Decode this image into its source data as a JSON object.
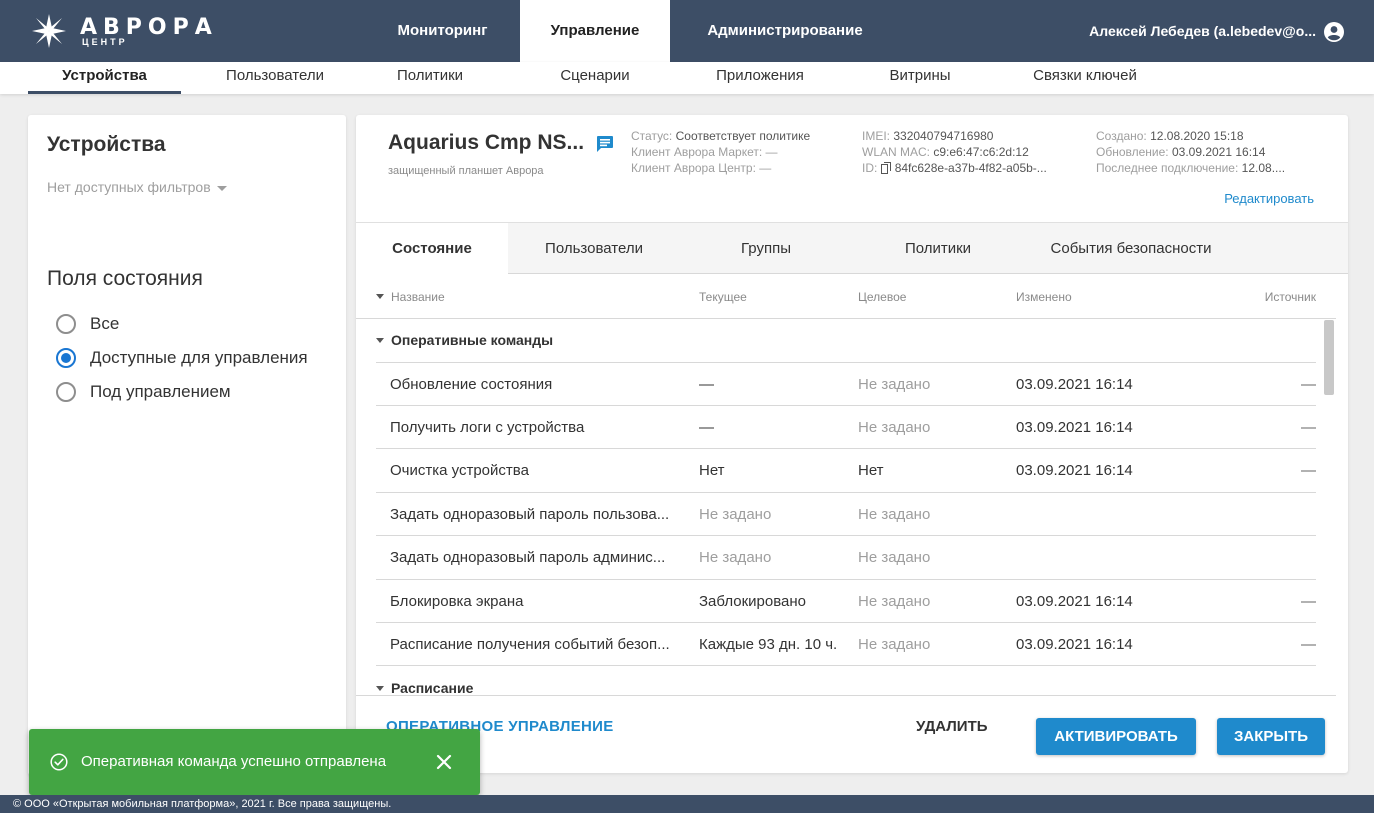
{
  "app": {
    "logo_title": "АВРОРА",
    "logo_subtitle": "ЦЕНТР",
    "logo_icon": "aurora-star-logo",
    "accent_color": "#1f8acc",
    "header_color": "#3d4e66",
    "success_color": "#43a543"
  },
  "main_nav": {
    "tabs": [
      {
        "label": "Мониторинг"
      },
      {
        "label": "Управление"
      },
      {
        "label": "Администрирование"
      }
    ],
    "active": "Управление",
    "user": {
      "name": "Алексей Лебедев (a.lebedev@o...",
      "icon": "user-account-icon"
    }
  },
  "sub_nav": {
    "items": [
      {
        "label": "Устройства"
      },
      {
        "label": "Пользователи"
      },
      {
        "label": "Политики"
      },
      {
        "label": "Сценарии"
      },
      {
        "label": "Приложения"
      },
      {
        "label": "Витрины"
      },
      {
        "label": "Связки ключей"
      }
    ],
    "active": "Устройства"
  },
  "left_panel": {
    "title": "Устройства",
    "filter_placeholder": "Нет доступных фильтров",
    "section_title": "Поля состояния",
    "options": [
      {
        "label": "Все",
        "checked": false
      },
      {
        "label": "Доступные для управления",
        "checked": true
      },
      {
        "label": "Под управлением",
        "checked": false
      }
    ]
  },
  "device": {
    "name": "Aquarius Cmp NS...",
    "type": "защищенный планшет Аврора",
    "status_label": "Статус:",
    "status_value": "Соответствует политике",
    "market_client_label": "Клиент Аврора Маркет:",
    "market_client_value": "—",
    "center_client_label": "Клиент Аврора Центр:",
    "center_client_value": "—",
    "imei_label": "IMEI:",
    "imei_value": "332040794716980",
    "wlan_label": "WLAN MAC:",
    "wlan_value": "c9:e6:47:c6:2d:12",
    "id_label": "ID:",
    "id_value": "84fc628e-a37b-4f82-a05b-...",
    "created_label": "Создано:",
    "created_value": "12.08.2020 15:18",
    "updated_label": "Обновление:",
    "updated_value": "03.09.2021 16:14",
    "last_conn_label": "Последнее подключение:",
    "last_conn_value": "12.08....",
    "edit_label": "Редактировать"
  },
  "detail_tabs": {
    "items": [
      {
        "label": "Состояние"
      },
      {
        "label": "Пользователи"
      },
      {
        "label": "Группы"
      },
      {
        "label": "Политики"
      },
      {
        "label": "События безопасности"
      }
    ],
    "active": "Состояние"
  },
  "table": {
    "columns": [
      "Название",
      "Текущее",
      "Целевое",
      "Изменено",
      "Источник"
    ],
    "group1": "Оперативные команды",
    "rows": [
      {
        "name": "Обновление состояния",
        "current": "—",
        "target": "Не задано",
        "changed": "03.09.2021 16:14",
        "source": "—"
      },
      {
        "name": "Получить логи с устройства",
        "current": "—",
        "target": "Не задано",
        "changed": "03.09.2021 16:14",
        "source": "—"
      },
      {
        "name": "Очистка устройства",
        "current": "Нет",
        "target": "Нет",
        "changed": "03.09.2021 16:14",
        "source": "—"
      },
      {
        "name": "Задать одноразовый пароль пользова...",
        "current": "Не задано",
        "target": "Не задано",
        "changed": "",
        "source": ""
      },
      {
        "name": "Задать одноразовый пароль админис...",
        "current": "Не задано",
        "target": "Не задано",
        "changed": "",
        "source": ""
      },
      {
        "name": "Блокировка экрана",
        "current": "Заблокировано",
        "target": "Не задано",
        "changed": "03.09.2021 16:14",
        "source": "—"
      },
      {
        "name": "Расписание получения событий безоп...",
        "current": "Каждые 93 дн. 10 ч.",
        "target": "Не задано",
        "changed": "03.09.2021 16:14",
        "source": "—"
      }
    ],
    "group2": "Расписание"
  },
  "actions": {
    "operative": "ОПЕРАТИВНОЕ УПРАВЛЕНИЕ",
    "delete": "УДАЛИТЬ",
    "activate": "АКТИВИРОВАТЬ",
    "close": "ЗАКРЫТЬ"
  },
  "toast": {
    "message": "Оперативная команда успешно отправлена",
    "icon": "check-circle-icon",
    "close_icon": "close-icon"
  },
  "footer": {
    "copyright": "© ООО «Открытая мобильная платформа», 2021 г. Все права защищены."
  }
}
